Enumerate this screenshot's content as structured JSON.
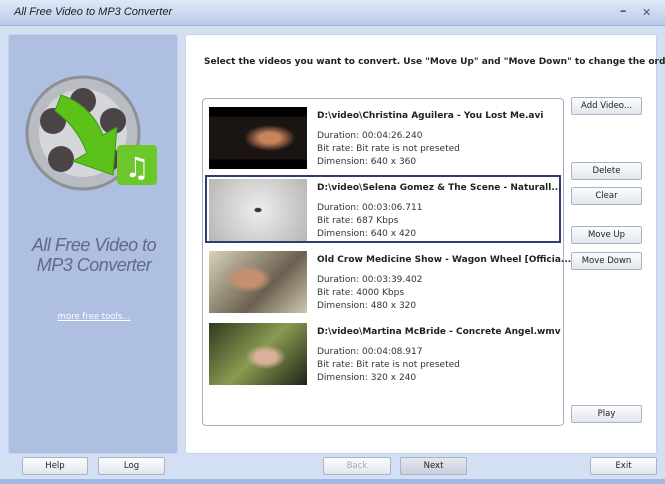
{
  "window": {
    "title": "All Free Video to MP3 Converter",
    "minimize": "–",
    "close": "✕"
  },
  "sidebar": {
    "logo_text_line1": "All Free Video to",
    "logo_text_line2": "MP3 Converter",
    "more_link": "more free tools..."
  },
  "main": {
    "instruction": "Select the videos you want to convert. Use \"Move Up\" and \"Move Down\" to change the order.",
    "videos": [
      {
        "name": "D:\\video\\Christina Aguilera - You Lost Me.avi",
        "duration": "Duration: 00:04:26.240",
        "bitrate": "Bit rate: Bit rate is not preseted",
        "dimension": "Dimension: 640 x 360",
        "selected": false
      },
      {
        "name": "D:\\video\\Selena Gomez & The Scene - Naturall...",
        "duration": "Duration: 00:03:06.711",
        "bitrate": "Bit rate: 687 Kbps",
        "dimension": "Dimension: 640 x 420",
        "selected": true
      },
      {
        "name": "Old Crow Medicine Show - Wagon Wheel [Officia...",
        "duration": "Duration: 00:03:39.402",
        "bitrate": "Bit rate: 4000 Kbps",
        "dimension": "Dimension: 480 x 320",
        "selected": false
      },
      {
        "name": "D:\\video\\Martina McBride - Concrete Angel.wmv",
        "duration": "Duration: 00:04:08.917",
        "bitrate": "Bit rate: Bit rate is not preseted",
        "dimension": "Dimension: 320 x 240",
        "selected": false
      }
    ],
    "buttons": {
      "add": "Add Video...",
      "delete": "Delete",
      "clear": "Clear",
      "move_up": "Move Up",
      "move_down": "Move Down",
      "play": "Play"
    }
  },
  "footer": {
    "help": "Help",
    "log": "Log",
    "back": "Back",
    "next": "Next",
    "exit": "Exit"
  }
}
